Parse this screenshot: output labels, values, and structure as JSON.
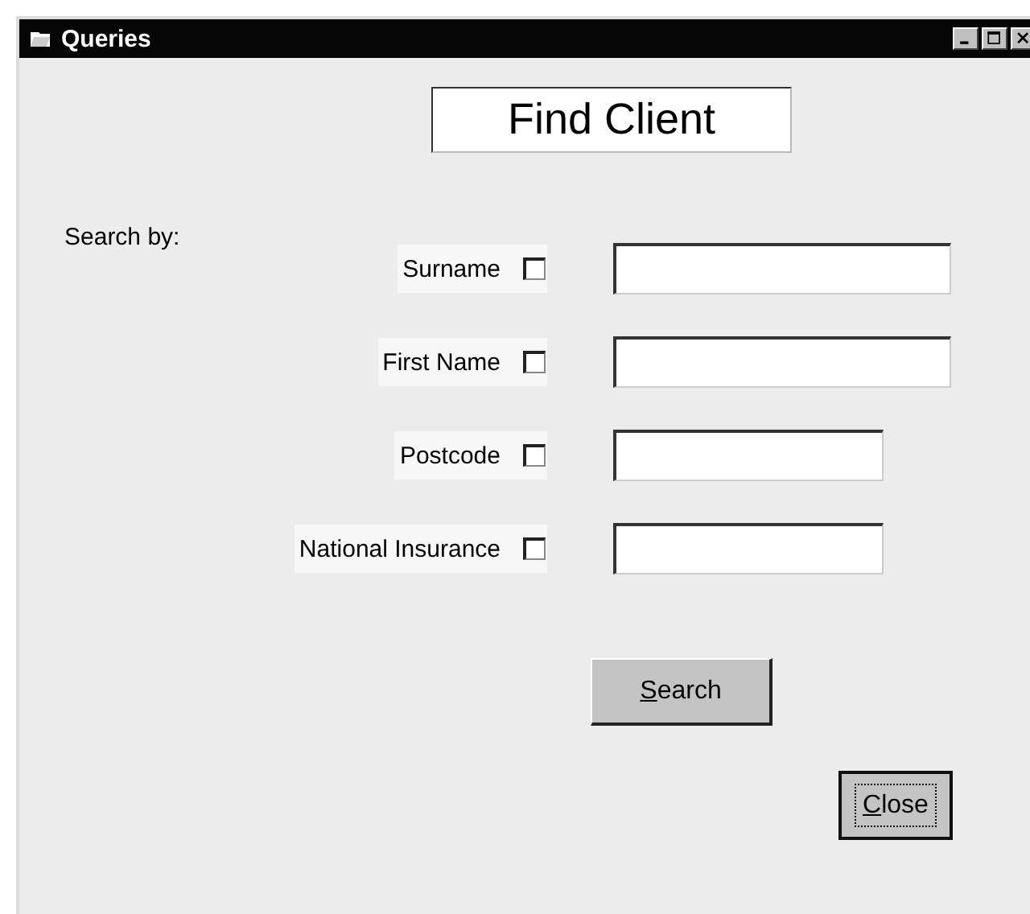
{
  "window": {
    "title": "Queries"
  },
  "heading": "Find Client",
  "search_by_label": "Search by:",
  "criteria": [
    {
      "label": "Surname",
      "checked": false,
      "wide": true
    },
    {
      "label": "First Name",
      "checked": false,
      "wide": true
    },
    {
      "label": "Postcode",
      "checked": false,
      "wide": false
    },
    {
      "label": "National Insurance",
      "checked": false,
      "wide": false
    }
  ],
  "buttons": [
    {
      "kind": "search",
      "label": "Search",
      "underline_first": true,
      "focused": false
    },
    {
      "kind": "close",
      "label": "Close",
      "underline_first": true,
      "focused": true
    }
  ]
}
